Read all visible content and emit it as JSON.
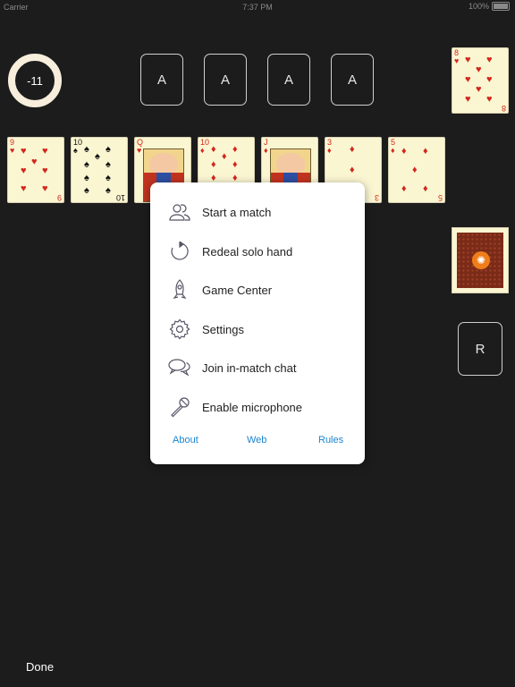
{
  "status_bar": {
    "carrier": "Carrier",
    "time": "7:37 PM",
    "battery": "100%"
  },
  "score": "-11",
  "foundations": [
    "A",
    "A",
    "A",
    "A"
  ],
  "top_right_card": {
    "rank": "8",
    "suit": "♥"
  },
  "tableau": [
    {
      "rank": "9",
      "suit": "♥",
      "color": "red"
    },
    {
      "rank": "10",
      "suit": "♠",
      "color": "black"
    },
    {
      "rank": "Q",
      "suit": "♥",
      "color": "red",
      "face": true
    },
    {
      "rank": "10",
      "suit": "♦",
      "color": "red"
    },
    {
      "rank": "J",
      "suit": "♦",
      "color": "red",
      "face": true
    },
    {
      "rank": "3",
      "suit": "♦",
      "color": "red"
    },
    {
      "rank": "5",
      "suit": "♦",
      "color": "red"
    }
  ],
  "reserve_label": "R",
  "menu": {
    "items": [
      {
        "label": "Start a match",
        "icon": "players-icon"
      },
      {
        "label": "Redeal solo hand",
        "icon": "redeal-icon"
      },
      {
        "label": "Game Center",
        "icon": "rocket-icon"
      },
      {
        "label": "Settings",
        "icon": "gear-icon"
      },
      {
        "label": "Join in-match chat",
        "icon": "chat-bubbles-icon"
      },
      {
        "label": "Enable microphone",
        "icon": "microphone-icon"
      }
    ],
    "links": {
      "about": "About",
      "web": "Web",
      "rules": "Rules"
    }
  },
  "done_label": "Done",
  "colors": {
    "background": "#1c1c1c",
    "card_face": "#fbf6d2",
    "red_suit": "#d3271c",
    "link": "#1b84d1",
    "card_back": "#7a2b18",
    "emblem": "#ef7d1a"
  }
}
